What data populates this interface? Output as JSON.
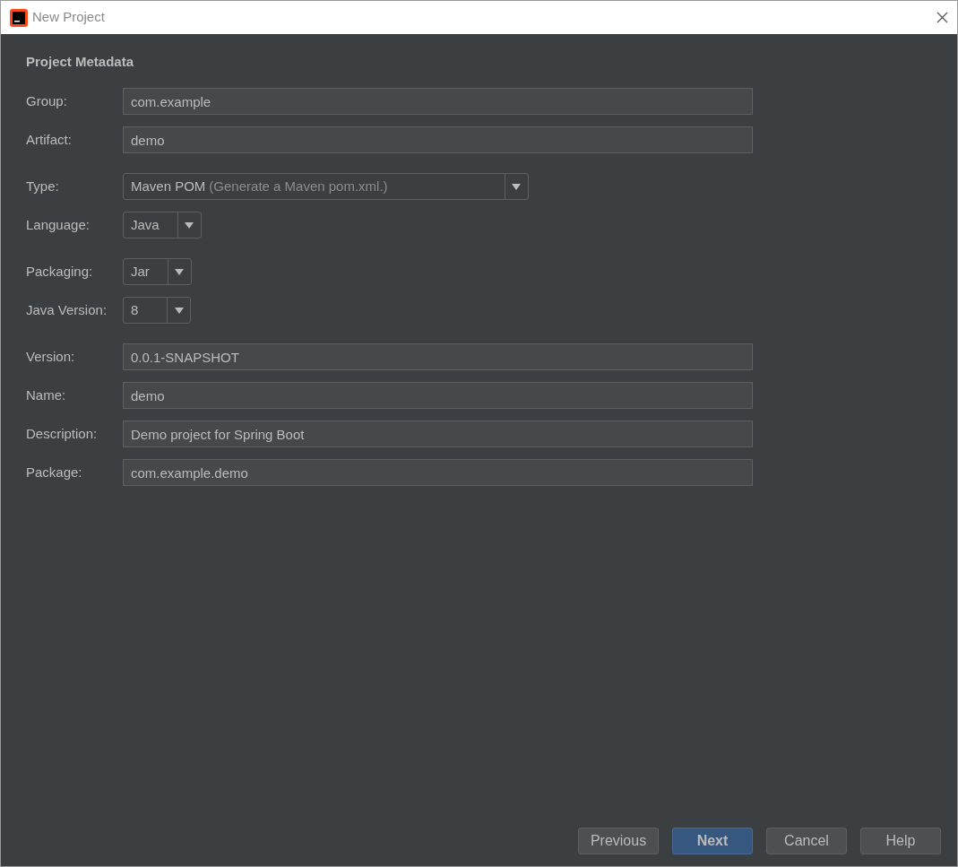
{
  "window": {
    "title": "New Project"
  },
  "section_title": "Project Metadata",
  "groups": [
    [
      {
        "label": "Group:",
        "kind": "text",
        "value": "com.example"
      },
      {
        "label": "Artifact:",
        "kind": "text",
        "value": "demo"
      }
    ],
    [
      {
        "label": "Type:",
        "kind": "select",
        "value": "Maven POM",
        "hint": "(Generate a Maven pom.xml.)"
      },
      {
        "label": "Language:",
        "kind": "select",
        "value": "Java"
      }
    ],
    [
      {
        "label": "Packaging:",
        "kind": "select",
        "value": "Jar"
      },
      {
        "label": "Java Version:",
        "kind": "select",
        "value": "8"
      }
    ],
    [
      {
        "label": "Version:",
        "kind": "text",
        "value": "0.0.1-SNAPSHOT"
      },
      {
        "label": "Name:",
        "kind": "text",
        "value": "demo"
      },
      {
        "label": "Description:",
        "kind": "text",
        "value": "Demo project for Spring Boot"
      },
      {
        "label": "Package:",
        "kind": "text",
        "value": "com.example.demo"
      }
    ]
  ],
  "buttons": [
    {
      "label": "Previous",
      "kind": "plain"
    },
    {
      "label": "Next",
      "kind": "default"
    },
    {
      "label": "Cancel",
      "kind": "plain"
    },
    {
      "label": "Help",
      "kind": "plain"
    }
  ]
}
